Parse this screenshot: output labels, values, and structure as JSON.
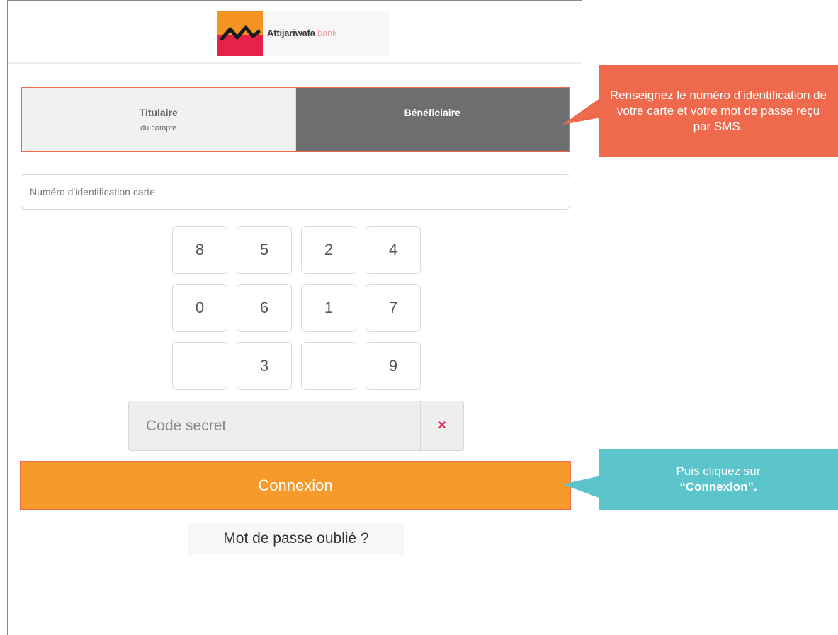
{
  "logo": {
    "name": "Attijariwafa",
    "suffix": "bank"
  },
  "tabs": [
    {
      "title": "Titulaire",
      "subtitle": "du compte",
      "active": false
    },
    {
      "title": "Bénéficiaire",
      "subtitle": "",
      "active": true
    }
  ],
  "card_input": {
    "placeholder": "Numéro d'identification carte",
    "value": ""
  },
  "keypad": {
    "keys": [
      "8",
      "5",
      "2",
      "4",
      "0",
      "6",
      "1",
      "7",
      "",
      "3",
      "",
      "9"
    ]
  },
  "secret_code": {
    "placeholder": "Code secret",
    "clear_symbol": "×"
  },
  "connexion": {
    "label": "Connexion"
  },
  "forgot_password": {
    "label": "Mot de passe oublié ?"
  },
  "callouts": {
    "first": "Renseignez le numéro d’identification de votre carte et votre mot de passe reçu par SMS.",
    "second_prefix": "Puis cliquez sur",
    "second_strong": "“Connexion”."
  },
  "colors": {
    "brand_orange": "#f69a2c",
    "brand_red": "#e5234a",
    "callout_orange": "#ef6a4c",
    "callout_teal": "#5bc5cb",
    "tab_active": "#6c6e70"
  }
}
